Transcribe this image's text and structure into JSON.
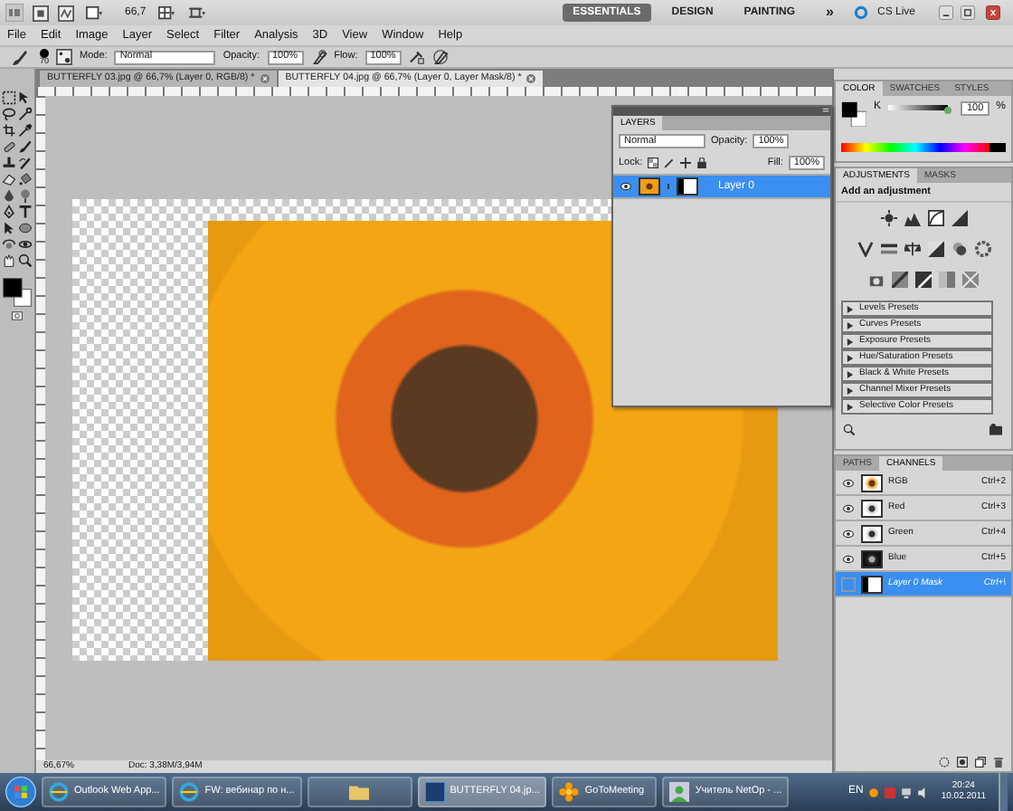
{
  "app_bar": {
    "zoom": "66,7",
    "workspaces": [
      {
        "label": "ESSENTIALS",
        "selected": true
      },
      {
        "label": "DESIGN",
        "selected": false
      },
      {
        "label": "PAINTING",
        "selected": false
      }
    ],
    "more": "»",
    "cs_live": "CS Live"
  },
  "menu": [
    "File",
    "Edit",
    "Image",
    "Layer",
    "Select",
    "Filter",
    "Analysis",
    "3D",
    "View",
    "Window",
    "Help"
  ],
  "options_bar": {
    "brush_size": "70",
    "mode_label": "Mode:",
    "mode": "Normal",
    "opacity_label": "Opacity:",
    "opacity": "100%",
    "flow_label": "Flow:",
    "flow": "100%"
  },
  "doc_tabs": [
    {
      "label": "BUTTERFLY 03.jpg @ 66,7% (Layer 0, RGB/8) *",
      "selected": false
    },
    {
      "label": "BUTTERFLY 04.jpg @ 66,7% (Layer 0, Layer Mask/8) *",
      "selected": true
    }
  ],
  "layers_panel": {
    "title": "LAYERS",
    "blend_mode": "Normal",
    "opacity_label": "Opacity:",
    "opacity": "100%",
    "lock_label": "Lock:",
    "fill_label": "Fill:",
    "fill": "100%",
    "layers": [
      {
        "name": "Layer 0",
        "selected": true,
        "visible": true
      }
    ]
  },
  "color_panel": {
    "tabs": [
      {
        "label": "COLOR",
        "selected": true
      },
      {
        "label": "SWATCHES",
        "selected": false
      },
      {
        "label": "STYLES",
        "selected": false
      }
    ],
    "channel": "K",
    "level": 1.0,
    "value": "100",
    "unit": "%"
  },
  "adjustments_panel": {
    "tabs": [
      {
        "label": "ADJUSTMENTS",
        "selected": true
      },
      {
        "label": "MASKS",
        "selected": false
      }
    ],
    "heading": "Add an adjustment",
    "presets": [
      "Levels Presets",
      "Curves Presets",
      "Exposure Presets",
      "Hue/Saturation Presets",
      "Black & White Presets",
      "Channel Mixer Presets",
      "Selective Color Presets"
    ]
  },
  "channels_panel": {
    "tabs": [
      {
        "label": "PATHS",
        "selected": false
      },
      {
        "label": "CHANNELS",
        "selected": true
      }
    ],
    "channels": [
      {
        "name": "RGB",
        "shortcut": "Ctrl+2",
        "visible": true,
        "selected": false,
        "kind": "photo"
      },
      {
        "name": "Red",
        "shortcut": "Ctrl+3",
        "visible": true,
        "selected": false,
        "kind": "gray"
      },
      {
        "name": "Green",
        "shortcut": "Ctrl+4",
        "visible": true,
        "selected": false,
        "kind": "gray"
      },
      {
        "name": "Blue",
        "shortcut": "Ctrl+5",
        "visible": true,
        "selected": false,
        "kind": "dark"
      },
      {
        "name": "Layer 0 Mask",
        "shortcut": "Ctrl+\\",
        "visible": false,
        "selected": true,
        "kind": "mask"
      }
    ]
  },
  "status_bar": {
    "zoom": "66,67%",
    "doc": "Doc: 3,38M/3,94M"
  },
  "taskbar": {
    "items": [
      {
        "kind": "browser",
        "label": "Outlook Web App...",
        "selected": false
      },
      {
        "kind": "browser",
        "label": "FW: вебинар по н...",
        "selected": false
      },
      {
        "kind": "folder",
        "selected": false
      },
      {
        "kind": "ps",
        "label": "BUTTERFLY 04.jp...",
        "selected": true
      },
      {
        "kind": "flower",
        "label": "GoToMeeting",
        "selected": false
      },
      {
        "kind": "person",
        "label": "Учитель NetOp - ...",
        "selected": false
      }
    ],
    "language": "EN",
    "time": "20:24",
    "date": "10.02.2011"
  }
}
